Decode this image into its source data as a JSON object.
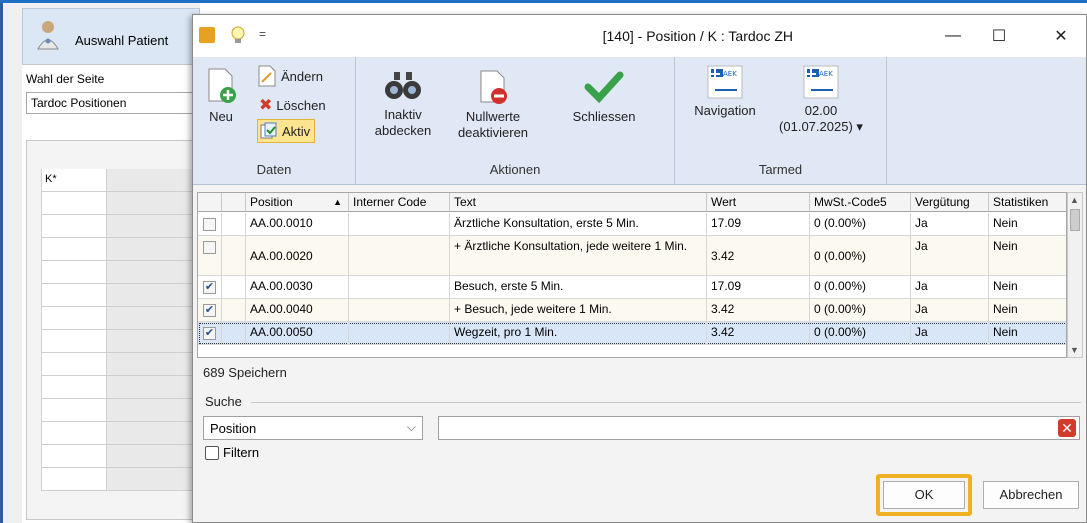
{
  "background_window": {
    "tab_label": "Auswahl Patient",
    "page_label": "Wahl der Seite",
    "page_select_value": "Tardoc Positionen",
    "grid_header": "K*",
    "row_count": 14
  },
  "dialog": {
    "title": "[140] - Position / K : Tardoc ZH",
    "quick_access_dropdown": "=",
    "window_buttons": {
      "minimize": "—",
      "maximize": "☐",
      "close": "✕"
    }
  },
  "ribbon": {
    "daten": {
      "label": "Daten",
      "neu": "Neu",
      "aendern": "Ändern",
      "loeschen": "Löschen",
      "aktiv": "Aktiv"
    },
    "aktionen": {
      "label": "Aktionen",
      "inaktiv_line1": "Inaktiv",
      "inaktiv_line2": "abdecken",
      "nullwerte_line1": "Nullwerte",
      "nullwerte_line2": "deaktivieren",
      "schliessen": "Schliessen"
    },
    "tarmed": {
      "label": "Tarmed",
      "navigation": "Navigation",
      "version_line1": "02.00",
      "version_line2": "(01.07.2025)",
      "version_arrow": "▾",
      "aek_label": "AEK"
    }
  },
  "grid": {
    "columns": [
      "Position",
      "Interner Code",
      "Text",
      "Wert",
      "MwSt.-Code5",
      "Vergütung",
      "Statistiken"
    ],
    "sort_indicator": "▲",
    "rows": [
      {
        "checked": false,
        "position": "AA.00.0010",
        "code": "",
        "text": "Ärztliche Konsultation, erste 5 Min.",
        "wert": "17.09",
        "mwst": "0 (0.00%)",
        "verguetung": "Ja",
        "statistiken": "Nein"
      },
      {
        "checked": false,
        "position": "AA.00.0020",
        "code": "",
        "text": "+ Ärztliche Konsultation, jede weitere 1 Min.",
        "wert": "3.42",
        "mwst": "0 (0.00%)",
        "verguetung": "Ja",
        "statistiken": "Nein"
      },
      {
        "checked": true,
        "position": "AA.00.0030",
        "code": "",
        "text": "Besuch, erste 5 Min.",
        "wert": "17.09",
        "mwst": "0 (0.00%)",
        "verguetung": "Ja",
        "statistiken": "Nein"
      },
      {
        "checked": true,
        "position": "AA.00.0040",
        "code": "",
        "text": "+ Besuch, jede weitere 1 Min.",
        "wert": "3.42",
        "mwst": "0 (0.00%)",
        "verguetung": "Ja",
        "statistiken": "Nein"
      },
      {
        "checked": true,
        "position": "AA.00.0050",
        "code": "",
        "text": "Wegzeit, pro 1 Min.",
        "wert": "3.42",
        "mwst": "0 (0.00%)",
        "verguetung": "Ja",
        "statistiken": "Nein"
      }
    ]
  },
  "status": {
    "speichern": "689 Speichern"
  },
  "search": {
    "label": "Suche",
    "field_select": "Position",
    "query": "",
    "filter_label": "Filtern",
    "filter_checked": false
  },
  "buttons": {
    "ok": "OK",
    "cancel": "Abbrechen"
  },
  "colors": {
    "highlight": "#f0b024",
    "ribbon_bg": "#dfe8f4",
    "selected_row": "#d9e6f7"
  }
}
